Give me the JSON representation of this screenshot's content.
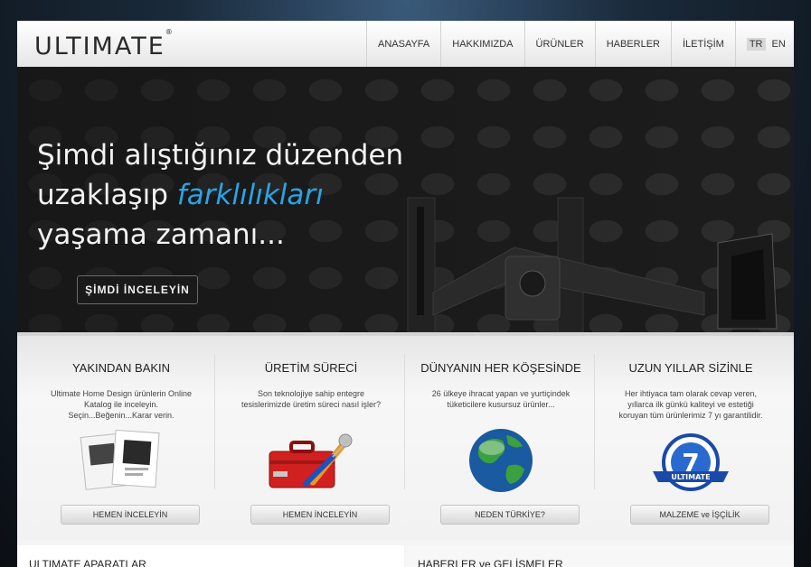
{
  "brand": {
    "logo": "ULTIMATE",
    "mark": "®"
  },
  "nav": {
    "items": [
      "ANASAYFA",
      "HAKKIMIZDA",
      "ÜRÜNLER",
      "HABERLER",
      "İLETİŞİM"
    ],
    "lang_tr": "TR",
    "lang_en": "EN"
  },
  "hero": {
    "line1": "Şimdi alıştığınız düzenden",
    "line2_prefix": "uzaklaşıp ",
    "line2_accent": "farklılıkları",
    "line3": "yaşama zamanı...",
    "button": "ŞİMDİ İNCELEYİN",
    "accent_color": "#2aa4e6"
  },
  "features": [
    {
      "title": "YAKINDAN BAKIN",
      "desc": "Ultimate Home Design ürünlerin Online Katalog ile inceleyin. Seçin...Beğenin...Karar verin.",
      "button": "HEMEN İNCELEYİN",
      "icon": "catalog-icon"
    },
    {
      "title": "ÜRETİM SÜRECİ",
      "desc": "Son teknolojiye sahip entegre tesislerimizde üretim süreci nasıl işler?",
      "button": "HEMEN İNCELEYİN",
      "icon": "toolbox-icon"
    },
    {
      "title": "DÜNYANIN HER KÖŞESİNDE",
      "desc": "26 ülkeye ihracat yapan ve yurtiçindek tüketicilere kusursuz ürünler...",
      "button": "NEDEN TÜRKİYE?",
      "icon": "globe-icon"
    },
    {
      "title": "UZUN YILLAR SİZİNLE",
      "desc": "Her ihtiyaca tam olarak cevap veren, yıllarca ilk günkü kaliteyi ve estetiği koruyan tüm ürünlerimiz 7 yı garantilidir.",
      "button": "MALZEME ve İŞÇİLİK",
      "icon": "warranty-badge-icon",
      "badge_number": "7",
      "badge_text": "ULTIMATE"
    }
  ],
  "bottom": {
    "left_title": "ULTIMATE APARATLAR",
    "right_title": "HABERLER ve GELİŞMELER"
  }
}
